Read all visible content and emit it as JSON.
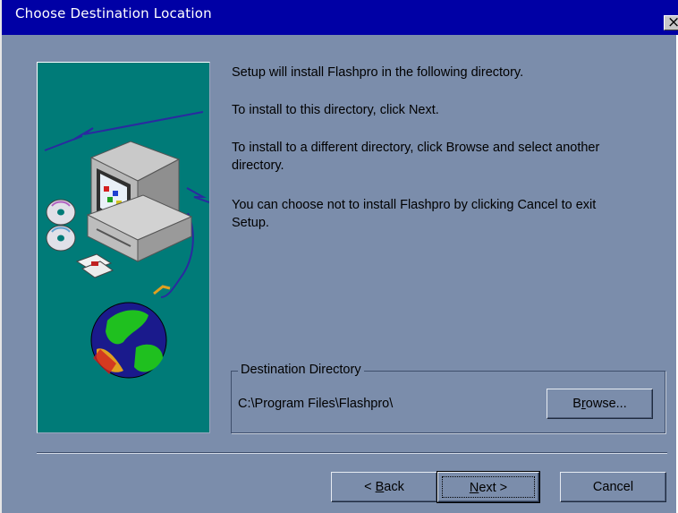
{
  "window": {
    "title": "Choose Destination Location",
    "close_glyph": "×"
  },
  "body": {
    "line1": "Setup will install Flashpro in the following directory.",
    "line2": "To install to this directory, click Next.",
    "line3": "To install to a different directory, click Browse and select another\ndirectory.",
    "line4": "You can choose not to install Flashpro by clicking Cancel to exit\nSetup."
  },
  "destination": {
    "group_label": "Destination Directory",
    "path": "C:\\Program Files\\Flashpro\\",
    "browse_label_pre": "B",
    "browse_label_u": "r",
    "browse_label_post": "owse..."
  },
  "buttons": {
    "back_pre": "< ",
    "back_u": "B",
    "back_post": "ack",
    "next_u": "N",
    "next_post": "ext >",
    "cancel": "Cancel"
  },
  "colors": {
    "titlebar": "#0000a5",
    "dialog": "#7b8dab",
    "image_bg": "#007b78"
  }
}
